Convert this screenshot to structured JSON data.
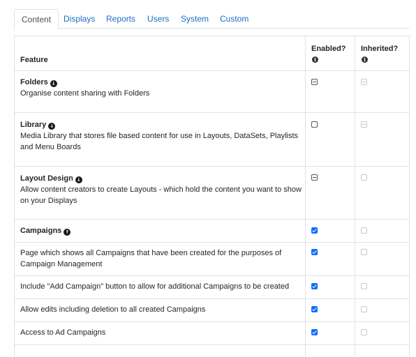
{
  "tabs": [
    {
      "label": "Content",
      "active": true
    },
    {
      "label": "Displays",
      "active": false
    },
    {
      "label": "Reports",
      "active": false
    },
    {
      "label": "Users",
      "active": false
    },
    {
      "label": "System",
      "active": false
    },
    {
      "label": "Custom",
      "active": false
    }
  ],
  "table": {
    "headers": {
      "feature": "Feature",
      "enabled": "Enabled?",
      "inherited": "Inherited?"
    },
    "rows": [
      {
        "title": "Folders",
        "expand_icon": "arrow-circle-down-icon",
        "description": "Organise content sharing with Folders",
        "enabled": "indeterminate",
        "inherited": "disabled-indeterminate"
      },
      {
        "title": "Library",
        "expand_icon": "arrow-circle-down-icon",
        "description": "Media Library that stores file based content for use in Layouts, DataSets, Playlists and Menu Boards",
        "enabled": "unchecked",
        "inherited": "disabled-indeterminate"
      },
      {
        "title": "Layout Design",
        "expand_icon": "arrow-circle-down-icon",
        "description": "Allow content creators to create Layouts - which hold the content you want to show on your Displays",
        "enabled": "indeterminate",
        "inherited": "disabled-empty"
      },
      {
        "title": "Campaigns",
        "expand_icon": "arrow-circle-up-icon",
        "description": "",
        "enabled": "checked",
        "inherited": "disabled-empty"
      },
      {
        "title": "",
        "description": "Page which shows all Campaigns that have been created for the purposes of Campaign Management",
        "enabled": "checked",
        "inherited": "disabled-empty"
      },
      {
        "title": "",
        "description": "Include \"Add Campaign\" button to allow for additional Campaigns to be created",
        "enabled": "checked",
        "inherited": "disabled-empty"
      },
      {
        "title": "",
        "description": "Allow edits including deletion to all created Campaigns",
        "enabled": "checked",
        "inherited": "disabled-empty"
      },
      {
        "title": "",
        "description": "Access to Ad Campaigns",
        "enabled": "checked",
        "inherited": "disabled-empty"
      }
    ]
  }
}
